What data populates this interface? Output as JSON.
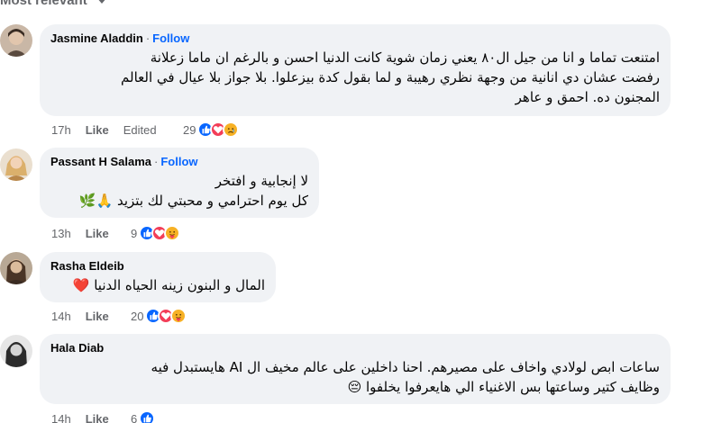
{
  "sort": {
    "label": "Most relevant"
  },
  "comments": [
    {
      "author": "Jasmine Aladdin",
      "follow": "Follow",
      "lines": [
        "امتنعت تماما و انا من جيل ال٨٠ يعني زمان شوية كانت الدنيا احسن و بالرغم ان ماما زعلانة",
        "رفضت عشان دي انانية من وجهة نظري رهيبة و لما بقول كدة بيزعلوا. بلا جواز بلا عيال في العالم",
        "المجنون ده. احمق و عاهر"
      ],
      "time": "17h",
      "like": "Like",
      "edited": "Edited",
      "reaction_count": "29",
      "reactions": [
        "like",
        "love",
        "sad"
      ]
    },
    {
      "author": "Passant H Salama",
      "follow": "Follow",
      "lines": [
        "لا إنجابية و افتخر",
        "كل يوم احترامي و محبتي لك بتزيد 🙏🌿"
      ],
      "time": "13h",
      "like": "Like",
      "reaction_count": "9",
      "reactions": [
        "like",
        "love",
        "care"
      ]
    },
    {
      "author": "Rasha Eldeib",
      "lines": [
        "المال و البنون زينه الحياه الدنيا ❤️"
      ],
      "time": "14h",
      "like": "Like",
      "reaction_count": "20",
      "reactions": [
        "like",
        "love",
        "care"
      ]
    },
    {
      "author": "Hala Diab",
      "lines": [
        "ساعات ابص لولادي واخاف على مصيرهم. احنا داخلين على عالم مخيف ال AI هايستبدل فيه",
        "وظايف كتير وساعتها بس الاغنياء الي هايعرفوا يخلفوا 😔"
      ],
      "time": "14h",
      "like": "Like",
      "reaction_count": "6",
      "reactions": [
        "like"
      ]
    }
  ],
  "colors": {
    "follow": "#0866ff",
    "bubble": "#f0f2f5",
    "meta": "#65676b",
    "like_blue": "#0866ff",
    "love_red": "#f33e58",
    "sad_yellow": "#f7b125"
  }
}
